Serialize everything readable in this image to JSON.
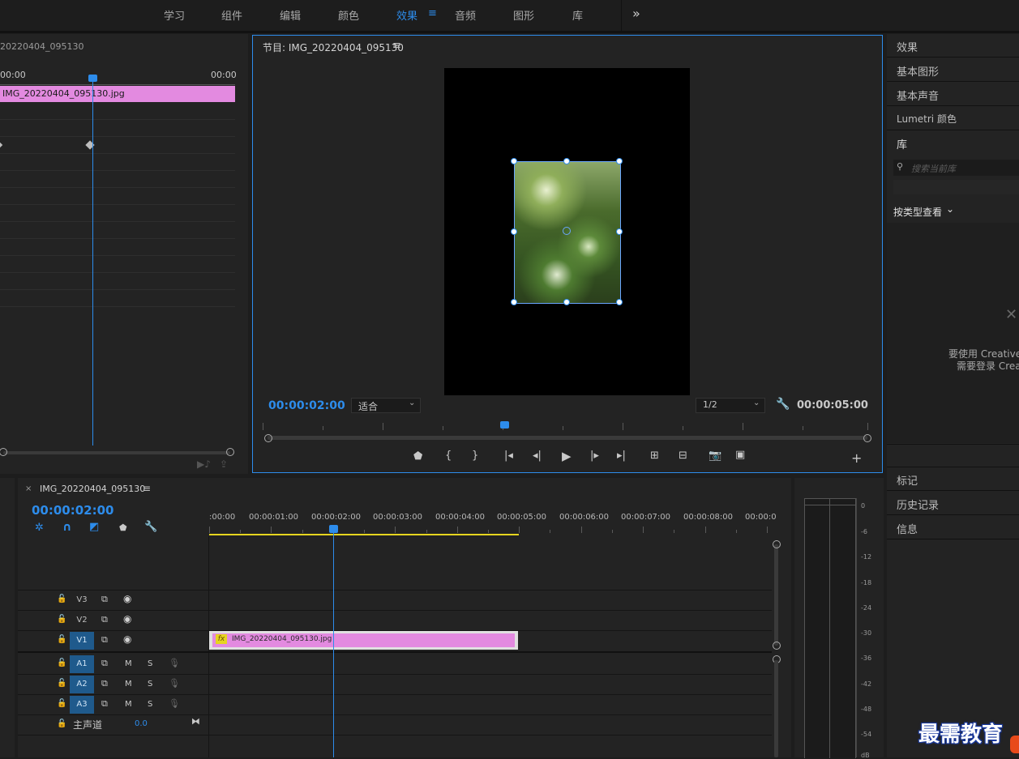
{
  "workspace_tabs": [
    "学习",
    "组件",
    "编辑",
    "颜色",
    "效果",
    "音频",
    "图形",
    "库"
  ],
  "active_workspace": "效果",
  "more_icon": "»",
  "source": {
    "title": "20220404_095130",
    "time_left": "00:00",
    "time_right": "00:00",
    "clip_label": "IMG_20220404_095130.jpg"
  },
  "program": {
    "title": "节目: IMG_20220404_095130",
    "timecode": "00:00:02:00",
    "fit_option": "适合",
    "resolution": "1/2",
    "duration": "00:00:05:00"
  },
  "right_panel": {
    "items_top": [
      "效果",
      "基本图形",
      "基本声音",
      "Lumetri 颜色",
      "库"
    ],
    "search_placeholder": "搜索当前库",
    "view_by_type": "按类型查看",
    "message_line1": "要使用 Creative",
    "message_line2": "需要登录 Crea",
    "items_bottom": [
      "标记",
      "历史记录",
      "信息"
    ]
  },
  "timeline": {
    "sequence_name": "IMG_20220404_095130",
    "timecode": "00:00:02:00",
    "ruler_labels": [
      ":00:00",
      "00:00:01:00",
      "00:00:02:00",
      "00:00:03:00",
      "00:00:04:00",
      "00:00:05:00",
      "00:00:06:00",
      "00:00:07:00",
      "00:00:08:00",
      "00:00:0"
    ],
    "video_tracks": [
      "V3",
      "V2",
      "V1"
    ],
    "audio_tracks": [
      "A1",
      "A2",
      "A3"
    ],
    "mute_label": "M",
    "solo_label": "S",
    "master_label": "主声道",
    "master_value": "0.0",
    "clip_label": "IMG_20220404_095130.jpg",
    "fx_label": "fx"
  },
  "meter": {
    "labels": [
      "0",
      "-6",
      "-12",
      "-18",
      "-24",
      "-30",
      "-36",
      "-42",
      "-48",
      "-54",
      "dB"
    ]
  },
  "watermark": "最需教育",
  "colors": {
    "accent": "#2d8ceb",
    "clip_pink": "#e38ae0",
    "work_area": "#e6d51f"
  }
}
